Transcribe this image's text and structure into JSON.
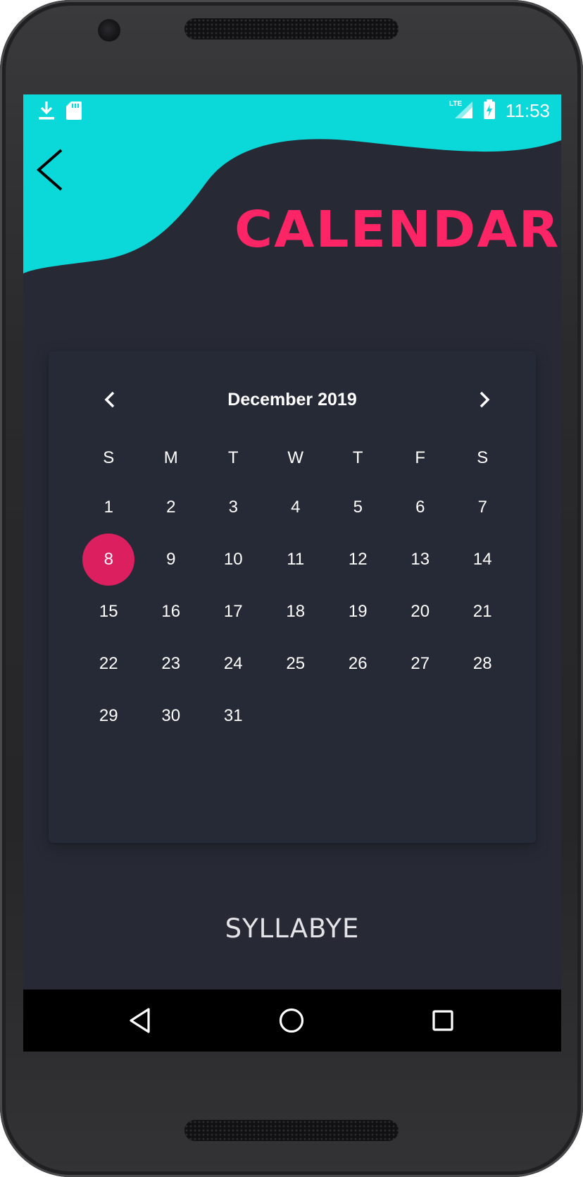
{
  "status_bar": {
    "time": "11:53",
    "left_icons": [
      "download-icon",
      "sd-card-icon"
    ],
    "right_icons": [
      "lte-signal-icon",
      "battery-charging-icon"
    ],
    "network_label": "LTE"
  },
  "header": {
    "title": "CALENDAR",
    "back_icon": "chevron-left-icon",
    "accent_color": "#fd2565",
    "wave_color": "#0bd9d9"
  },
  "calendar": {
    "month_label": "December 2019",
    "prev_icon": "chevron-left-icon",
    "next_icon": "chevron-right-icon",
    "weekdays": [
      "S",
      "M",
      "T",
      "W",
      "T",
      "F",
      "S"
    ],
    "days": [
      "1",
      "2",
      "3",
      "4",
      "5",
      "6",
      "7",
      "8",
      "9",
      "10",
      "11",
      "12",
      "13",
      "14",
      "15",
      "16",
      "17",
      "18",
      "19",
      "20",
      "21",
      "22",
      "23",
      "24",
      "25",
      "26",
      "27",
      "28",
      "29",
      "30",
      "31"
    ],
    "selected_day": "8",
    "selected_color": "#dc1f5f"
  },
  "footer": {
    "brand": "SYLLABYE"
  },
  "navigation_bar": {
    "keys": [
      "back-triangle-icon",
      "home-circle-icon",
      "recents-square-icon"
    ]
  }
}
